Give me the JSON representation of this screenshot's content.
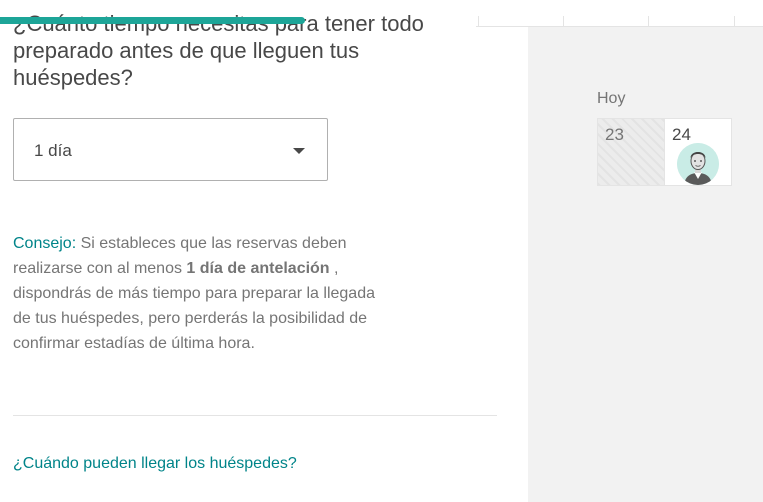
{
  "progress": {
    "fraction": 0.4,
    "color": "#1da598"
  },
  "question": {
    "text": "¿Cuánto tiempo necesitas para tener todo preparado antes de que lleguen tus huéspedes?"
  },
  "notice_select": {
    "value": "1 día",
    "icon": "chevron-down-icon"
  },
  "tip": {
    "label": "Consejo:",
    "text_1": " Si estableces que las reservas deben realizarse con al menos ",
    "bold": "1 día de antelación",
    "text_2": " , dispondrás de más tiempo para preparar la llegada de tus huéspedes, pero perderás la posibilidad de confirmar estadías de última hora."
  },
  "next_question": {
    "text": "¿Cuándo pueden llegar los huéspedes?"
  },
  "calendar": {
    "today_label": "Hoy",
    "days": [
      {
        "number": "23",
        "state": "past"
      },
      {
        "number": "24",
        "state": "today",
        "icon": "guest-avatar-icon"
      }
    ]
  },
  "colors": {
    "accent": "#008489",
    "progress": "#1da598",
    "text": "#484848",
    "muted_text": "#757575",
    "panel_bg": "#f2f2f2"
  }
}
